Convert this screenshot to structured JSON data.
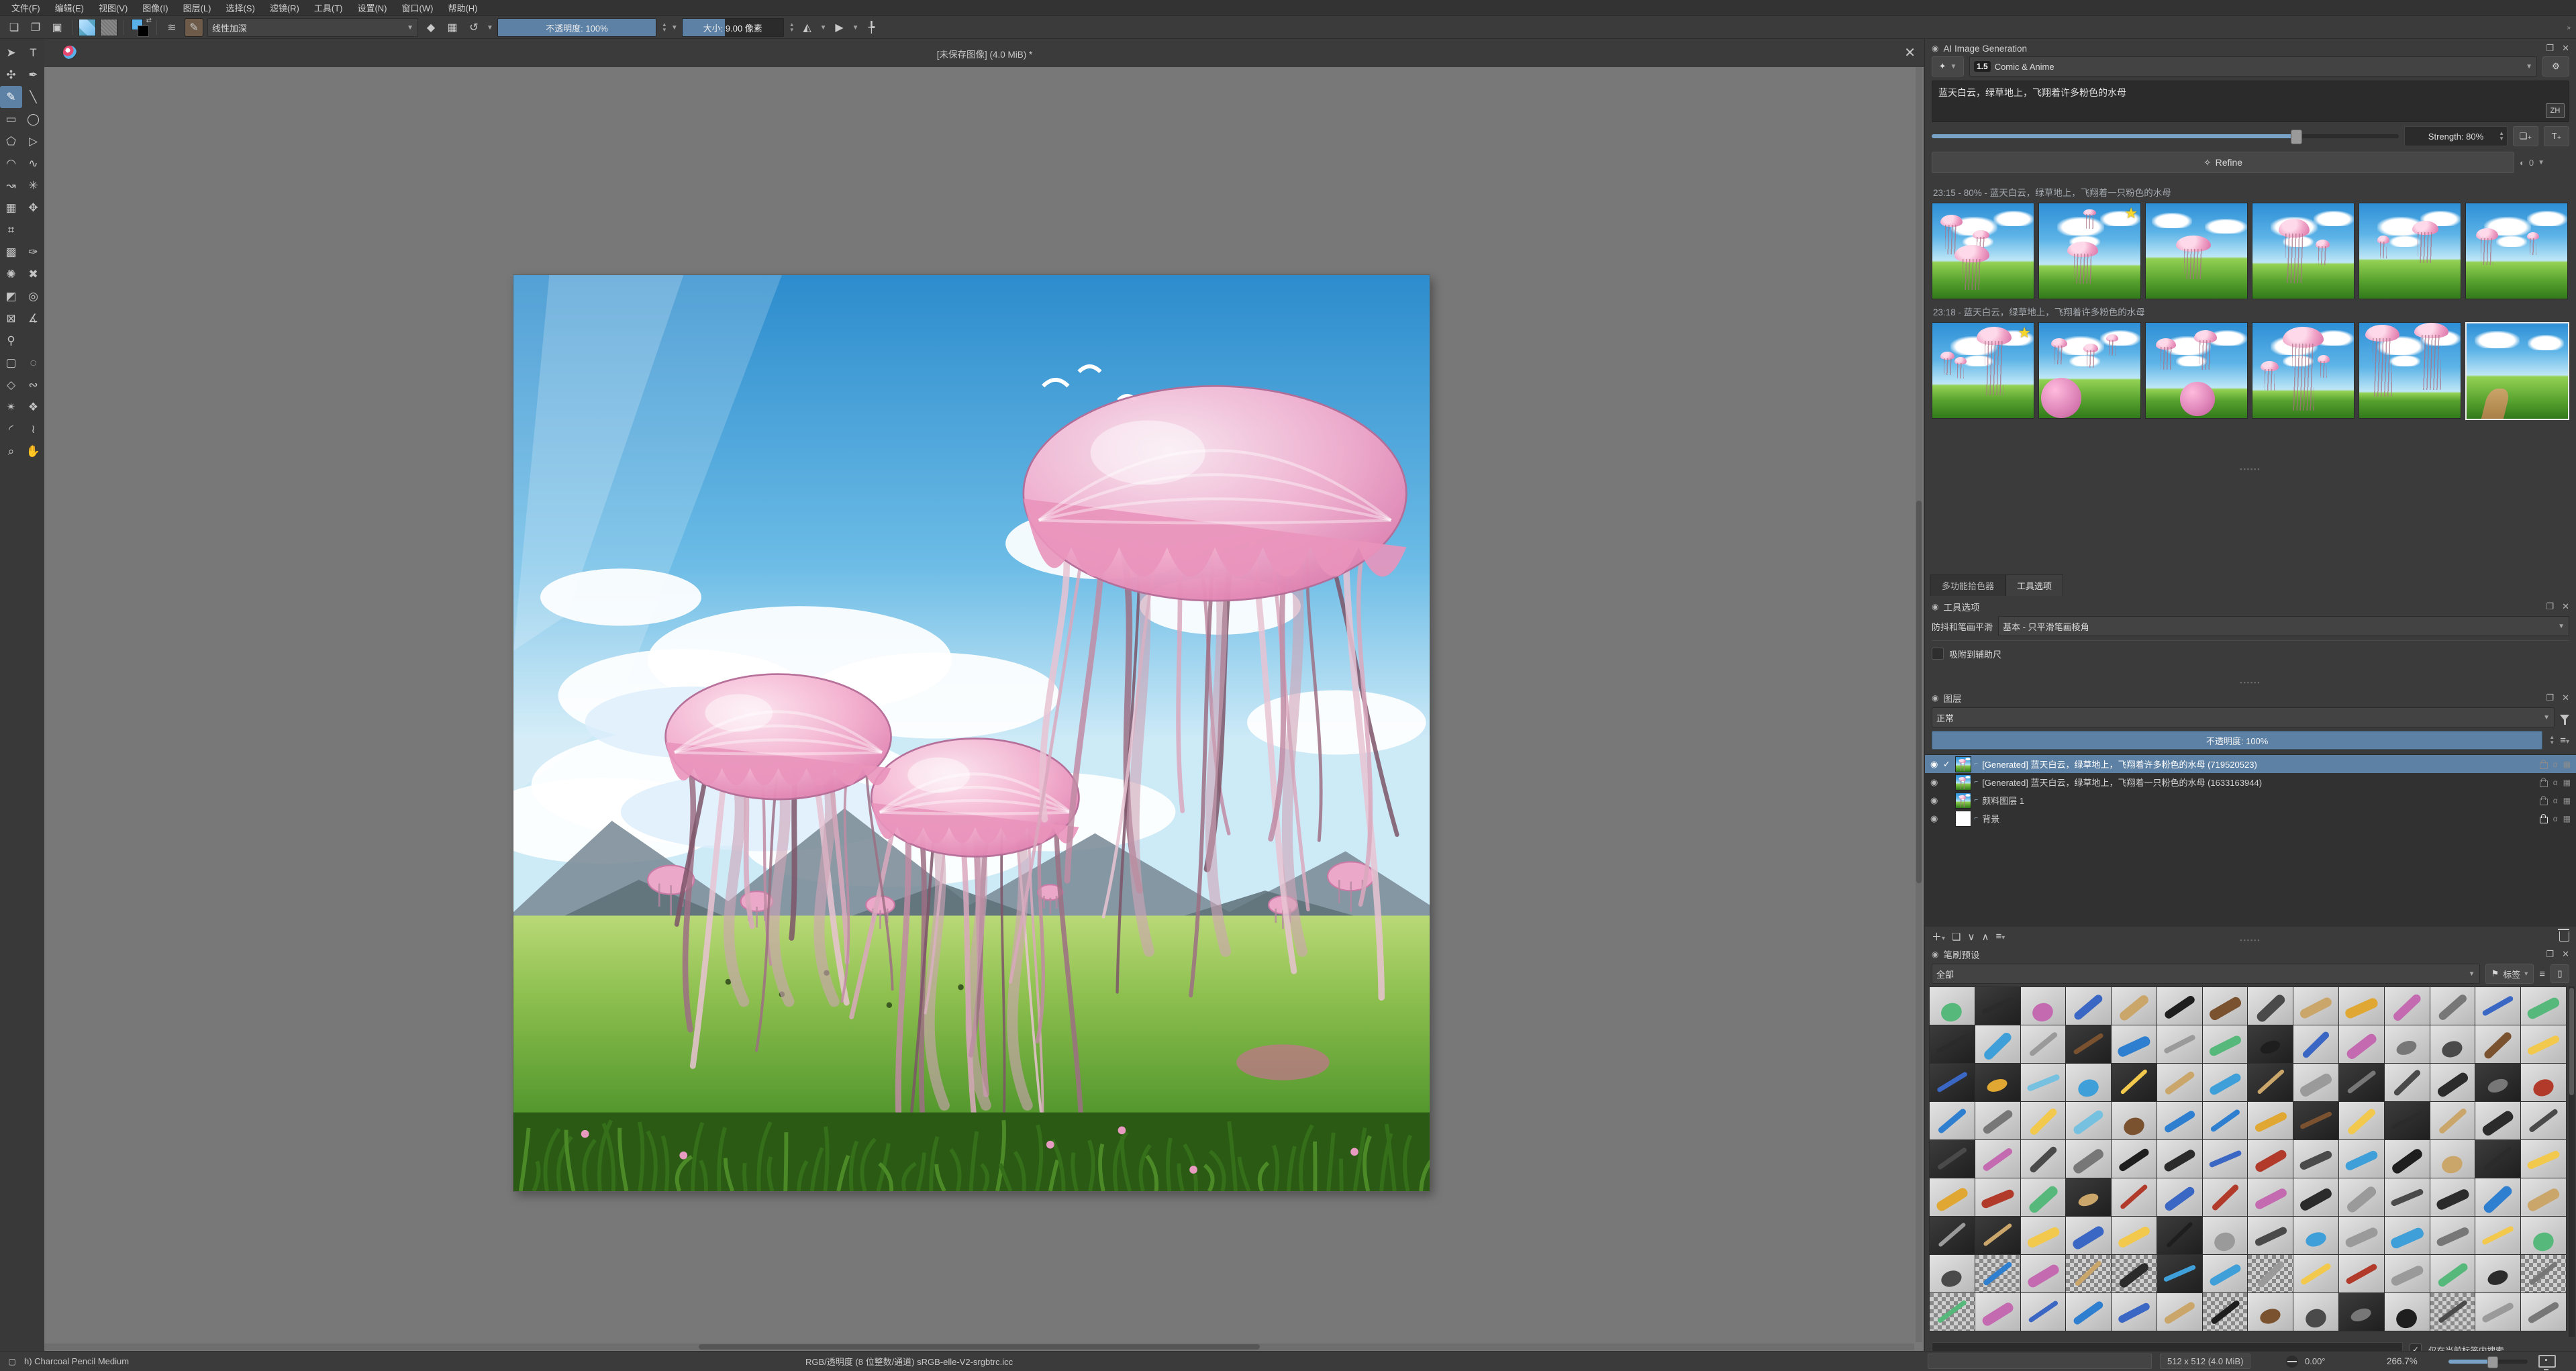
{
  "menu": {
    "items": [
      "文件(F)",
      "编辑(E)",
      "视图(V)",
      "图像(I)",
      "图层(L)",
      "选择(S)",
      "滤镜(R)",
      "工具(T)",
      "设置(N)",
      "窗口(W)",
      "帮助(H)"
    ]
  },
  "toolbar": {
    "blend_mode": "线性加深",
    "opacity_label": "不透明度: 100%",
    "opacity_fill_pct": 100,
    "size_label": "大小:  9.00 像素",
    "size_fill_pct": 42,
    "overflow": "»"
  },
  "toolbox": {
    "tools": [
      {
        "name": "select-shapes-tool",
        "glyph": "➤"
      },
      {
        "name": "text-tool",
        "glyph": "T"
      },
      {
        "name": "edit-shapes-tool",
        "glyph": "✣"
      },
      {
        "name": "calligraphy-tool",
        "glyph": "✒"
      },
      {
        "name": "freehand-brush-tool",
        "glyph": "✎",
        "selected": true
      },
      {
        "name": "line-tool",
        "glyph": "╲"
      },
      {
        "name": "rectangle-tool",
        "glyph": "▭"
      },
      {
        "name": "ellipse-tool",
        "glyph": "◯"
      },
      {
        "name": "polygon-tool",
        "glyph": "⬠"
      },
      {
        "name": "polyline-tool",
        "glyph": "▷"
      },
      {
        "name": "bezier-curve-tool",
        "glyph": "◠"
      },
      {
        "name": "freehand-path-tool",
        "glyph": "∿"
      },
      {
        "name": "dynamic-brush-tool",
        "glyph": "↝"
      },
      {
        "name": "multibrush-tool",
        "glyph": "✳"
      },
      {
        "name": "transform-tool",
        "glyph": "▦"
      },
      {
        "name": "move-tool",
        "glyph": "✥"
      },
      {
        "name": "crop-tool",
        "glyph": "⌗"
      },
      {
        "name": "spacer",
        "glyph": ""
      },
      {
        "name": "gradient-tool",
        "glyph": "▩"
      },
      {
        "name": "color-sampler-tool",
        "glyph": "✑"
      },
      {
        "name": "pattern-edit-tool",
        "glyph": "✺"
      },
      {
        "name": "smart-patch-tool",
        "glyph": "✖"
      },
      {
        "name": "fill-tool",
        "glyph": "◩"
      },
      {
        "name": "enclose-fill-tool",
        "glyph": "◎"
      },
      {
        "name": "assistants-tool",
        "glyph": "⊠"
      },
      {
        "name": "measure-tool",
        "glyph": "∡"
      },
      {
        "name": "reference-images-tool",
        "glyph": "⚲"
      },
      {
        "name": "spacer2",
        "glyph": ""
      },
      {
        "name": "rect-select-tool",
        "glyph": "▢"
      },
      {
        "name": "ellipse-select-tool",
        "glyph": "◌"
      },
      {
        "name": "polygon-select-tool",
        "glyph": "◇"
      },
      {
        "name": "freehand-select-tool",
        "glyph": "∾"
      },
      {
        "name": "similar-select-tool",
        "glyph": "✴"
      },
      {
        "name": "magnetic-select-tool",
        "glyph": "❖"
      },
      {
        "name": "bezier-select-tool",
        "glyph": "◜"
      },
      {
        "name": "contiguous-select-tool",
        "glyph": "≀"
      },
      {
        "name": "zoom-tool",
        "glyph": "⌕"
      },
      {
        "name": "pan-tool",
        "glyph": "✋"
      }
    ]
  },
  "canvas": {
    "title": "[未保存图像] (4.0 MiB) *",
    "close_glyph": "✕"
  },
  "ai": {
    "title": "AI Image Generation",
    "style_badge": "1.5",
    "style_value": "Comic & Anime",
    "prompt": "蓝天白云，绿草地上，飞翔着许多粉色的水母",
    "lang_badge": "ZH",
    "strength_label": "Strength: 80%",
    "strength_pct": 78,
    "refine_label": "Refine",
    "queue_count": "0",
    "history": [
      {
        "header": "23:15 - 80% - 蓝天白云，绿草地上，飞翔着一只粉色的水母",
        "count": 6,
        "star": 1,
        "selected": -1
      },
      {
        "header": "23:18 - 蓝天白云，绿草地上，飞翔着许多粉色的水母",
        "count": 6,
        "star": 0,
        "selected": 5
      }
    ]
  },
  "tool_options": {
    "tab_picker": "多功能拾色器",
    "tab_tool": "工具选项",
    "title": "工具选项",
    "smoothing_label": "防抖和笔画平滑",
    "smoothing_value": "基本 - 只平滑笔画棱角",
    "snap_label": "吸附到辅助尺"
  },
  "layers": {
    "title": "图层",
    "blend_mode": "正常",
    "opacity_label": "不透明度: 100%",
    "rows": [
      {
        "name": "[Generated] 蓝天白云，绿草地上，飞翔着许多粉色的水母 (719520523)",
        "selected": true,
        "locked": false,
        "thumb": "scene1",
        "checked": true
      },
      {
        "name": "[Generated] 蓝天白云，绿草地上，飞翔着一只粉色的水母 (1633163944)",
        "selected": false,
        "locked": false,
        "thumb": "scene2",
        "checked": false
      },
      {
        "name": "颜料图层 1",
        "selected": false,
        "locked": false,
        "thumb": "scene3",
        "checked": false
      },
      {
        "name": "背景",
        "selected": false,
        "locked": true,
        "thumb": "white",
        "checked": false
      }
    ]
  },
  "brushes": {
    "title": "笔刷预设",
    "filter_all": "全部",
    "tag_label": "标签",
    "search_check_label": "仅在当前标签内搜索",
    "grid": {
      "cols": 14,
      "rows": 9,
      "palette": [
        "#3a66c4",
        "#2f7fd0",
        "#777777",
        "#4a4a4a",
        "#1e1e1e",
        "#caa66a",
        "#e0a832",
        "#f2c94c",
        "#7a5230",
        "#b23a2a",
        "#76c1e0",
        "#3f9fd8",
        "#9a9a9a",
        "#c46ab0",
        "#56b87a",
        "#2b2b2b"
      ]
    }
  },
  "statusbar": {
    "brush_name": "h) Charcoal Pencil Medium",
    "colorspace": "RGB/透明度 (8 位整数/通道)  sRGB-elle-V2-srgbtrc.icc",
    "doc_size": "512 x 512 (4.0 MiB)",
    "angle": "0.00°",
    "zoom": "266.7%",
    "zoom_fill_pct": 55
  },
  "colors": {
    "accent": "#5d81a5",
    "slider_blue": "#7aa3c9",
    "canvas_gray": "#787878",
    "star": "#f7d62e"
  }
}
